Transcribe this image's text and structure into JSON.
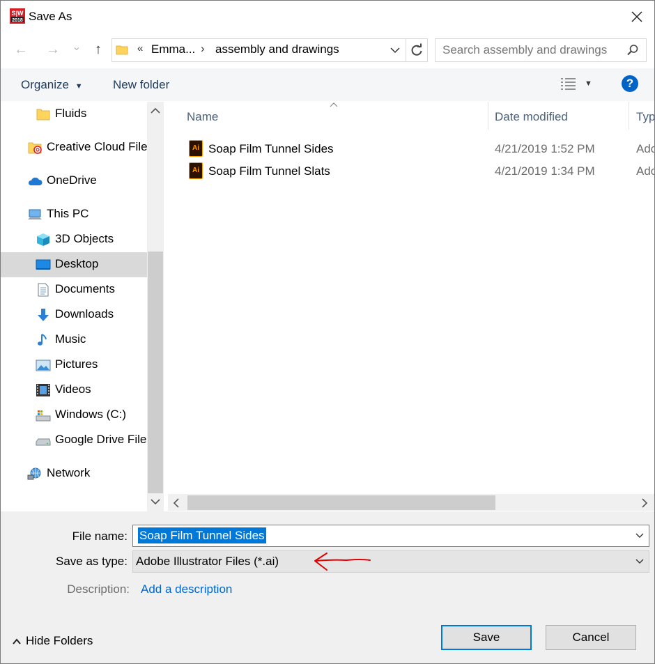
{
  "window": {
    "title": "Save As",
    "app_logo_text": "SW 2018"
  },
  "nav": {
    "back_glyph": "←",
    "forward_glyph": "→",
    "recent_glyph": "⌄",
    "up_glyph": "↑"
  },
  "address": {
    "overflow": "«",
    "crumbs": [
      "Emma...",
      "assembly and drawings"
    ],
    "separator": "›"
  },
  "search": {
    "placeholder": "Search assembly and drawings"
  },
  "toolbar": {
    "organize": "Organize",
    "new_folder": "New folder",
    "help": "?"
  },
  "sidebar": {
    "items": [
      {
        "label": "Fluids",
        "icon": "folder-icon"
      },
      {
        "label": "Creative Cloud Files",
        "icon": "creative-cloud-icon"
      },
      {
        "label": "OneDrive",
        "icon": "cloud-icon"
      },
      {
        "label": "This PC",
        "icon": "computer-icon"
      },
      {
        "label": "3D Objects",
        "icon": "cube-icon"
      },
      {
        "label": "Desktop",
        "icon": "desktop-icon",
        "selected": true
      },
      {
        "label": "Documents",
        "icon": "document-icon"
      },
      {
        "label": "Downloads",
        "icon": "download-icon"
      },
      {
        "label": "Music",
        "icon": "music-icon"
      },
      {
        "label": "Pictures",
        "icon": "pictures-icon"
      },
      {
        "label": "Videos",
        "icon": "film-icon"
      },
      {
        "label": "Windows (C:)",
        "icon": "drive-icon"
      },
      {
        "label": "Google Drive File Stream",
        "icon": "drive-icon"
      },
      {
        "label": "Network",
        "icon": "network-icon"
      }
    ]
  },
  "file_list": {
    "columns": [
      "Name",
      "Date modified",
      "Type"
    ],
    "rows": [
      {
        "name": "Soap Film Tunnel Sides",
        "date": "4/21/2019 1:52 PM",
        "type": "Adobe Illustrator Artwork"
      },
      {
        "name": "Soap Film Tunnel Slats",
        "date": "4/21/2019 1:34 PM",
        "type": "Adobe Illustrator Artwork"
      }
    ],
    "icon_text": "Ai"
  },
  "form": {
    "file_name_label": "File name:",
    "file_name_value": "Soap Film Tunnel Sides",
    "save_as_type_label": "Save as type:",
    "save_as_type_value": "Adobe Illustrator Files (*.ai)",
    "description_label": "Description:",
    "description_link": "Add a description"
  },
  "footer": {
    "hide_folders": "Hide Folders",
    "save": "Save",
    "cancel": "Cancel"
  },
  "colors": {
    "accent": "#0078d7",
    "selection_gray": "#d9d9d9",
    "annotation_arrow": "#e00000"
  }
}
